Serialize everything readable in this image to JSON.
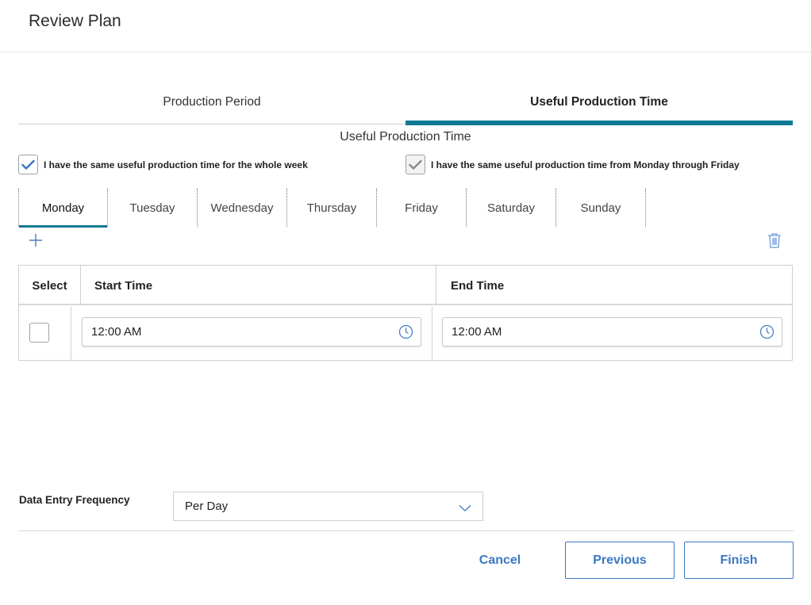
{
  "header": {
    "title": "Review Plan"
  },
  "main_tabs": [
    {
      "label": "Production Period",
      "active": false
    },
    {
      "label": "Useful Production Time",
      "active": true
    }
  ],
  "section_title": "Useful Production Time",
  "options": {
    "same_whole_week": {
      "label": "I have the same useful production time for the whole week",
      "checked": true
    },
    "same_mon_fri": {
      "label": "I have the same useful production time from Monday through Friday",
      "checked": true,
      "disabled": true
    }
  },
  "days": [
    {
      "label": "Monday",
      "active": true
    },
    {
      "label": "Tuesday",
      "active": false
    },
    {
      "label": "Wednesday",
      "active": false
    },
    {
      "label": "Thursday",
      "active": false
    },
    {
      "label": "Friday",
      "active": false
    },
    {
      "label": "Saturday",
      "active": false
    },
    {
      "label": "Sunday",
      "active": false
    }
  ],
  "toolbar": {
    "add_icon": "plus-icon",
    "delete_icon": "trash-icon"
  },
  "grid": {
    "headers": [
      "Select",
      "Start Time",
      "End Time"
    ],
    "rows": [
      {
        "selected": false,
        "start_time": "12:00 AM",
        "end_time": "12:00 AM"
      }
    ]
  },
  "frequency": {
    "label": "Data Entry Frequency",
    "value": "Per Day"
  },
  "buttons": {
    "cancel": "Cancel",
    "previous": "Previous",
    "finish": "Finish"
  },
  "colors": {
    "accent": "#0f7a92",
    "link": "#3a78c4",
    "check": "#3a78c4",
    "check_disabled": "#8a8a8a"
  }
}
